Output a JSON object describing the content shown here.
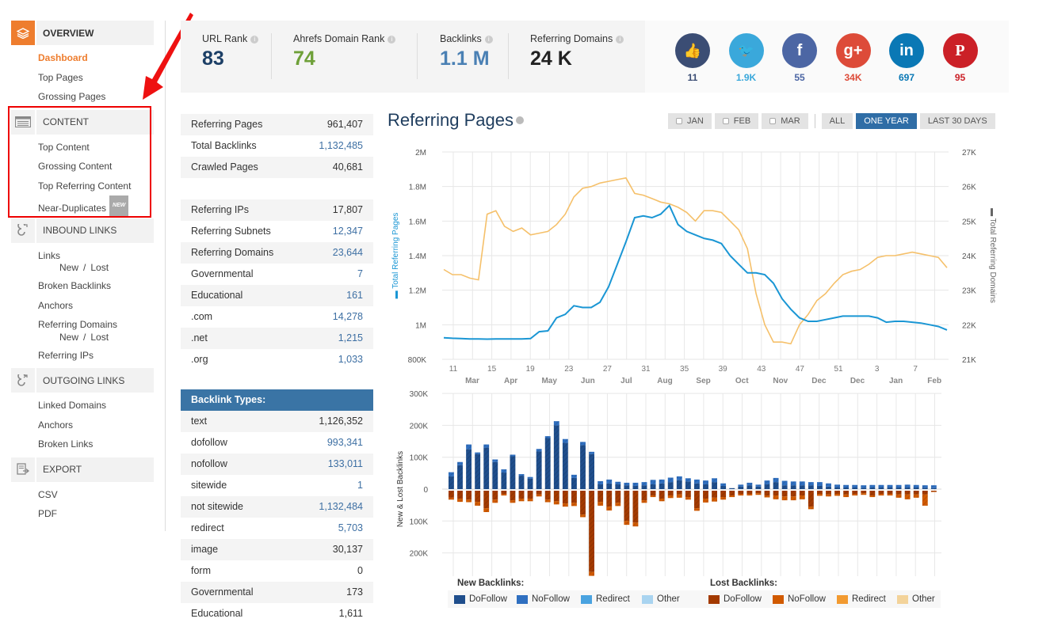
{
  "sidebar": {
    "sections": [
      {
        "title": "OVERVIEW",
        "icon": "layers-icon",
        "active": true,
        "items": [
          {
            "label": "Dashboard",
            "active": true
          },
          {
            "label": "Top Pages"
          },
          {
            "label": "Grossing Pages"
          }
        ]
      },
      {
        "title": "CONTENT",
        "icon": "list-icon",
        "items": [
          {
            "label": "Top Content"
          },
          {
            "label": "Grossing Content"
          },
          {
            "label": "Top Referring Content"
          },
          {
            "label": "Near-Duplicates",
            "badge": "NEW"
          }
        ]
      },
      {
        "title": "INBOUND LINKS",
        "icon": "inbound-link-icon",
        "items": [
          {
            "label": "Links",
            "sub": [
              "New",
              "Lost"
            ]
          },
          {
            "label": "Broken Backlinks"
          },
          {
            "label": "Anchors"
          },
          {
            "label": "Referring Domains",
            "sub": [
              "New",
              "Lost"
            ]
          },
          {
            "label": "Referring IPs"
          }
        ]
      },
      {
        "title": "OUTGOING LINKS",
        "icon": "outgoing-link-icon",
        "items": [
          {
            "label": "Linked Domains"
          },
          {
            "label": "Anchors"
          },
          {
            "label": "Broken Links"
          }
        ]
      },
      {
        "title": "EXPORT",
        "icon": "export-icon",
        "items": [
          {
            "label": "CSV"
          },
          {
            "label": "PDF"
          }
        ]
      }
    ],
    "sub_separator": "/"
  },
  "stats": [
    {
      "label": "URL Rank",
      "value": "83",
      "color": "#1c3f66"
    },
    {
      "label": "Ahrefs Domain Rank",
      "value": "74",
      "color": "#6ea038"
    },
    {
      "label": "Backlinks",
      "value": "1.1 M",
      "color": "#4a80b4"
    },
    {
      "label": "Referring Domains",
      "value": "24 K",
      "color": "#222222"
    }
  ],
  "social": [
    {
      "name": "like",
      "icon": "thumbs-up-icon",
      "glyph": "👍",
      "count": "11",
      "bg": "#3b4d74",
      "color": "#3b4d74"
    },
    {
      "name": "twitter",
      "icon": "twitter-icon",
      "glyph": "🐦",
      "count": "1.9K",
      "bg": "#3aa8db",
      "color": "#3aa8db"
    },
    {
      "name": "facebook",
      "icon": "facebook-icon",
      "glyph": "f",
      "count": "55",
      "bg": "#4c66a4",
      "color": "#4c66a4"
    },
    {
      "name": "google-plus",
      "icon": "google-plus-icon",
      "glyph": "g+",
      "count": "34K",
      "bg": "#dd4b39",
      "color": "#dd4b39"
    },
    {
      "name": "linkedin",
      "icon": "linkedin-icon",
      "glyph": "in",
      "count": "697",
      "bg": "#0a78b5",
      "color": "#0a78b5"
    },
    {
      "name": "pinterest",
      "icon": "pinterest-icon",
      "glyph": "P",
      "count": "95",
      "bg": "#cb2027",
      "color": "#cb2027"
    }
  ],
  "summary_table": [
    {
      "label": "Referring Pages",
      "value": "961,407",
      "link": false
    },
    {
      "label": "Total Backlinks",
      "value": "1,132,485",
      "link": true
    },
    {
      "label": "Crawled Pages",
      "value": "40,681",
      "link": false
    },
    {
      "label": "",
      "value": "",
      "link": false
    },
    {
      "label": "Referring IPs",
      "value": "17,807",
      "link": false
    },
    {
      "label": "Referring Subnets",
      "value": "12,347",
      "link": true
    },
    {
      "label": "Referring Domains",
      "value": "23,644",
      "link": true
    },
    {
      "label": "Governmental",
      "value": "7",
      "link": true
    },
    {
      "label": "Educational",
      "value": "161",
      "link": true
    },
    {
      "label": ".com",
      "value": "14,278",
      "link": true
    },
    {
      "label": ".net",
      "value": "1,215",
      "link": true
    },
    {
      "label": ".org",
      "value": "1,033",
      "link": true
    }
  ],
  "backlink_types": {
    "title": "Backlink Types:",
    "rows": [
      {
        "label": "text",
        "value": "1,126,352",
        "link": false
      },
      {
        "label": "dofollow",
        "value": "993,341",
        "link": true
      },
      {
        "label": "nofollow",
        "value": "133,011",
        "link": true
      },
      {
        "label": "sitewide",
        "value": "1",
        "link": true
      },
      {
        "label": "not sitewide",
        "value": "1,132,484",
        "link": true
      },
      {
        "label": "redirect",
        "value": "5,703",
        "link": true
      },
      {
        "label": "image",
        "value": "30,137",
        "link": false
      },
      {
        "label": "form",
        "value": "0",
        "link": false
      },
      {
        "label": "Governmental",
        "value": "173",
        "link": false
      },
      {
        "label": "Educational",
        "value": "1,611",
        "link": false
      }
    ]
  },
  "chart_header": {
    "title": "Referring Pages",
    "buttons": [
      {
        "label": "JAN",
        "checkbox": true
      },
      {
        "label": "FEB",
        "checkbox": true
      },
      {
        "label": "MAR",
        "checkbox": true
      },
      {
        "label": "ALL"
      },
      {
        "label": "ONE YEAR",
        "active": true
      },
      {
        "label": "LAST 30 DAYS"
      }
    ]
  },
  "chart_data": [
    {
      "type": "line",
      "title": "Referring Pages",
      "ylabel": "Total Referring Pages",
      "y2label": "Total Referring Domains",
      "ylim": [
        800000,
        2000000
      ],
      "y2lim": [
        21000,
        27000
      ],
      "y_ticks": [
        "800K",
        "1M",
        "1.2M",
        "1.4M",
        "1.6M",
        "1.8M",
        "2M"
      ],
      "y2_ticks": [
        "21K",
        "22K",
        "23K",
        "24K",
        "25K",
        "26K",
        "27K"
      ],
      "x_week_ticks": [
        "11",
        "15",
        "19",
        "23",
        "27",
        "31",
        "35",
        "39",
        "43",
        "47",
        "51",
        "3",
        "7"
      ],
      "x_month_ticks": [
        "Mar",
        "Apr",
        "May",
        "Jun",
        "Jul",
        "Aug",
        "Sep",
        "Oct",
        "Nov",
        "Dec",
        "Dec",
        "Jan",
        "Feb"
      ],
      "grid": true,
      "series": [
        {
          "name": "Total Referring Pages",
          "axis": "left",
          "color": "#1a96d4",
          "values": [
            925000,
            922000,
            920000,
            918000,
            918000,
            917000,
            918000,
            918000,
            918000,
            918000,
            920000,
            960000,
            965000,
            1040000,
            1060000,
            1110000,
            1100000,
            1100000,
            1130000,
            1220000,
            1350000,
            1480000,
            1620000,
            1630000,
            1620000,
            1640000,
            1690000,
            1580000,
            1540000,
            1520000,
            1500000,
            1490000,
            1470000,
            1400000,
            1350000,
            1300000,
            1300000,
            1290000,
            1240000,
            1150000,
            1090000,
            1040000,
            1020000,
            1020000,
            1030000,
            1040000,
            1050000,
            1050000,
            1050000,
            1050000,
            1040000,
            1015000,
            1020000,
            1020000,
            1015000,
            1010000,
            1000000,
            990000,
            970000
          ]
        },
        {
          "name": "Total Referring Domains",
          "axis": "right",
          "color": "#f5c06a",
          "values": [
            23600,
            23450,
            23450,
            23350,
            23300,
            25200,
            25300,
            24850,
            24700,
            24800,
            24600,
            24650,
            24700,
            24900,
            25200,
            25700,
            25950,
            26000,
            26100,
            26150,
            26200,
            26250,
            25800,
            25750,
            25650,
            25550,
            25500,
            25400,
            25250,
            25000,
            25300,
            25300,
            25250,
            25000,
            24750,
            24200,
            22900,
            22000,
            21500,
            21500,
            21450,
            22000,
            22300,
            22700,
            22900,
            23200,
            23450,
            23550,
            23600,
            23750,
            23950,
            24000,
            24000,
            24050,
            24100,
            24050,
            24000,
            23950,
            23650
          ]
        }
      ]
    },
    {
      "type": "bar",
      "title": "New & Lost Backlinks",
      "ylabel": "New & Lost Backlinks",
      "ylim": [
        -260000,
        300000
      ],
      "y_ticks": [
        "300K",
        "200K",
        "100K",
        "0",
        "100K",
        "200K"
      ],
      "grid": true,
      "legend": {
        "new_title": "New Backlinks:",
        "lost_title": "Lost Backlinks:",
        "new": [
          {
            "label": "DoFollow",
            "color": "#1f4e8c"
          },
          {
            "label": "NoFollow",
            "color": "#2f6fc0"
          },
          {
            "label": "Redirect",
            "color": "#4aa3e0"
          },
          {
            "label": "Other",
            "color": "#a9d4f0"
          }
        ],
        "lost": [
          {
            "label": "DoFollow",
            "color": "#a33a00"
          },
          {
            "label": "NoFollow",
            "color": "#d15a00"
          },
          {
            "label": "Redirect",
            "color": "#f29a30"
          },
          {
            "label": "Other",
            "color": "#f3d39a"
          }
        ]
      },
      "series": [
        {
          "name": "New DoFollow",
          "values": [
            40000,
            75000,
            125000,
            110000,
            130000,
            85000,
            52000,
            103000,
            42000,
            33000,
            118000,
            160000,
            200000,
            145000,
            35000,
            138000,
            110000,
            15000,
            18000,
            15000,
            12000,
            10000,
            12000,
            15000,
            18000,
            22000,
            28000,
            24000,
            18000,
            15000,
            22000,
            10000,
            3000,
            8000,
            12000,
            8000,
            15000,
            22000,
            12000,
            12000,
            12000,
            12000,
            10000,
            8000,
            6000,
            5000,
            5000,
            4000,
            5000,
            5000,
            5000,
            5000,
            5000,
            5000,
            4000,
            3000
          ]
        },
        {
          "name": "New NoFollow",
          "values": [
            13000,
            10000,
            15000,
            5000,
            10000,
            8000,
            10000,
            5000,
            5000,
            5000,
            8000,
            6000,
            13000,
            12000,
            10000,
            10000,
            7000,
            10000,
            12000,
            8000,
            8000,
            10000,
            10000,
            14000,
            12000,
            14000,
            12000,
            10000,
            12000,
            12000,
            12000,
            8000,
            0,
            6000,
            8000,
            6000,
            12000,
            13000,
            14000,
            12000,
            12000,
            10000,
            12000,
            10000,
            8000,
            8000,
            8000,
            8000,
            8000,
            8000,
            8000,
            8000,
            9000,
            8000,
            8000,
            9000
          ]
        },
        {
          "name": "Lost DoFollow",
          "values": [
            -22000,
            -25000,
            -28000,
            -35000,
            -55000,
            -28000,
            -10000,
            -30000,
            -25000,
            -25000,
            -12000,
            -28000,
            -33000,
            -40000,
            -38000,
            -75000,
            -255000,
            -35000,
            -50000,
            -38000,
            -95000,
            -100000,
            -30000,
            -15000,
            -25000,
            -15000,
            -12000,
            -20000,
            -55000,
            -25000,
            -22000,
            -20000,
            -15000,
            -10000,
            -10000,
            -8000,
            -15000,
            -15000,
            -18000,
            -18000,
            -15000,
            -50000,
            -10000,
            -12000,
            -10000,
            -12000,
            -10000,
            -8000,
            -15000,
            -10000,
            -10000,
            -12000,
            -12000,
            -12000,
            -12000,
            -3000
          ]
        },
        {
          "name": "Lost NoFollow",
          "values": [
            -6000,
            -10000,
            -8000,
            -12000,
            -12000,
            -10000,
            -5000,
            -8000,
            -8000,
            -8000,
            -6000,
            -8000,
            -10000,
            -10000,
            -10000,
            -8000,
            -12000,
            -12000,
            -12000,
            -10000,
            -12000,
            -12000,
            -8000,
            -5000,
            -8000,
            -8000,
            -10000,
            -8000,
            -8000,
            -12000,
            -12000,
            -8000,
            -5000,
            -5000,
            -5000,
            -5000,
            -6000,
            -12000,
            -12000,
            -12000,
            -12000,
            -8000,
            -6000,
            -6000,
            -6000,
            -8000,
            -5000,
            -5000,
            -5000,
            -5000,
            -5000,
            -10000,
            -15000,
            -10000,
            -35000,
            -1000
          ]
        }
      ]
    }
  ]
}
